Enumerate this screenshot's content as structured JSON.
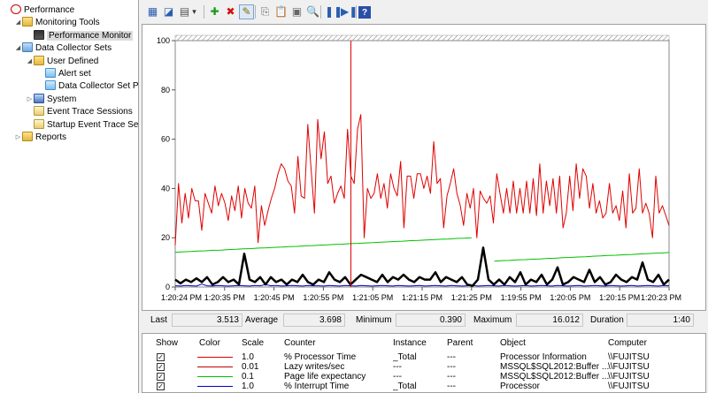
{
  "tree": {
    "items": [
      {
        "label": "Performance",
        "level": 0,
        "expander": "",
        "icon": "performance-icon",
        "cls": "ico-perf"
      },
      {
        "label": "Monitoring Tools",
        "level": 1,
        "expander": "◢",
        "icon": "folder-icon",
        "cls": "ico-folder"
      },
      {
        "label": "Performance Monitor",
        "level": 2,
        "expander": "",
        "icon": "monitor-icon",
        "cls": "ico-monitor",
        "selected": true
      },
      {
        "label": "Data Collector Sets",
        "level": 1,
        "expander": "◢",
        "icon": "data-collector-icon",
        "cls": "ico-dcs"
      },
      {
        "label": "User Defined",
        "level": 2,
        "expander": "◢",
        "icon": "user-defined-icon",
        "cls": "ico-user"
      },
      {
        "label": "Alert set",
        "level": 3,
        "expander": "",
        "icon": "alert-set-icon",
        "cls": "ico-alert"
      },
      {
        "label": "Data Collector Set P",
        "level": 3,
        "expander": "",
        "icon": "collector-set-icon",
        "cls": "ico-alert"
      },
      {
        "label": "System",
        "level": 2,
        "expander": "▷",
        "icon": "system-icon",
        "cls": "ico-sys"
      },
      {
        "label": "Event Trace Sessions",
        "level": 2,
        "expander": "",
        "icon": "event-trace-icon",
        "cls": "ico-trace"
      },
      {
        "label": "Startup Event Trace Ses",
        "level": 2,
        "expander": "",
        "icon": "startup-trace-icon",
        "cls": "ico-trace"
      },
      {
        "label": "Reports",
        "level": 1,
        "expander": "▷",
        "icon": "reports-icon",
        "cls": "ico-report"
      }
    ]
  },
  "toolbar": {
    "buttons": [
      {
        "name": "view-current-activity-button",
        "glyph": "▦",
        "color": "#2a5db0"
      },
      {
        "name": "view-log-data-button",
        "glyph": "◪",
        "color": "#2a5db0"
      },
      {
        "name": "change-graph-type-button",
        "glyph": "▤",
        "color": "#555"
      },
      {
        "name": "graph-type-dropdown-button",
        "glyph": "▾",
        "color": "#333"
      },
      {
        "name": "add-counter-button",
        "glyph": "✚",
        "color": "#1a9a1a"
      },
      {
        "name": "delete-counter-button",
        "glyph": "✖",
        "color": "#d01010"
      },
      {
        "name": "highlight-button",
        "glyph": "✎",
        "color": "#8a6a00",
        "active": true
      },
      {
        "name": "copy-properties-button",
        "glyph": "⎘",
        "color": "#777"
      },
      {
        "name": "paste-counter-list-button",
        "glyph": "📋",
        "color": "#777"
      },
      {
        "name": "properties-button",
        "glyph": "▣",
        "color": "#666"
      },
      {
        "name": "zoom-button",
        "glyph": "🔍",
        "color": "#555"
      },
      {
        "name": "freeze-display-button",
        "glyph": "❚❚",
        "color": "#2a5db0"
      },
      {
        "name": "update-data-button",
        "glyph": "▶❚",
        "color": "#2a5db0"
      },
      {
        "name": "help-button",
        "glyph": "?",
        "color": "#fff"
      }
    ]
  },
  "stats": {
    "last_label": "Last",
    "last_value": "3.513",
    "average_label": "Average",
    "average_value": "3.698",
    "minimum_label": "Minimum",
    "minimum_value": "0.390",
    "maximum_label": "Maximum",
    "maximum_value": "16.012",
    "duration_label": "Duration",
    "duration_value": "1:40"
  },
  "table": {
    "headers": {
      "show": "Show",
      "color": "Color",
      "scale": "Scale",
      "counter": "Counter",
      "instance": "Instance",
      "parent": "Parent",
      "object": "Object",
      "computer": "Computer"
    },
    "rows": [
      {
        "show": "✓",
        "color": "#e00000",
        "scale": "1.0",
        "counter": "% Processor Time",
        "instance": "_Total",
        "parent": "---",
        "object": "Processor Information",
        "computer": "\\\\FUJITSU"
      },
      {
        "show": "✓",
        "color": "#c00000",
        "scale": "0.01",
        "counter": "Lazy writes/sec",
        "instance": "---",
        "parent": "---",
        "object": "MSSQL$SQL2012:Buffer ...",
        "computer": "\\\\FUJITSU"
      },
      {
        "show": "✓",
        "color": "#00c000",
        "scale": "0.1",
        "counter": "Page life expectancy",
        "instance": "---",
        "parent": "---",
        "object": "MSSQL$SQL2012:Buffer ...",
        "computer": "\\\\FUJITSU"
      },
      {
        "show": "✓",
        "color": "#0000c0",
        "scale": "1.0",
        "counter": "% Interrupt Time",
        "instance": "_Total",
        "parent": "---",
        "object": "Processor",
        "computer": "\\\\FUJITSU"
      }
    ]
  },
  "chart_data": {
    "type": "line",
    "ylim": [
      0,
      100
    ],
    "yticks": [
      "0",
      "20",
      "40",
      "60",
      "80",
      "100"
    ],
    "xticks": [
      "1:20:24 PM",
      "1:20:35 PM",
      "1:20:45 PM",
      "1:20:55 PM",
      "1:21:05 PM",
      "1:21:15 PM",
      "1:21:25 PM",
      "1:19:55 PM",
      "1:20:05 PM",
      "1:20:15 PM",
      "1:20:23 PM"
    ],
    "current_position_index": 53,
    "series": [
      {
        "color": "#e00000",
        "width": 1,
        "values": [
          17,
          42,
          26,
          38,
          28,
          40,
          35,
          35,
          23,
          38,
          34,
          30,
          41,
          33,
          38,
          34,
          27,
          37,
          31,
          41,
          28,
          40,
          34,
          32,
          41,
          18,
          33,
          25,
          31,
          36,
          40,
          46,
          50,
          48,
          43,
          41,
          30,
          53,
          37,
          36,
          66,
          48,
          30,
          68,
          52,
          63,
          42,
          45,
          34,
          38,
          41,
          36,
          64,
          45,
          42,
          64,
          70,
          20,
          40,
          36,
          38,
          46,
          36,
          42,
          32,
          46,
          40,
          37,
          51,
          24,
          45,
          45,
          36,
          46,
          46,
          40,
          45,
          38,
          59,
          42,
          44,
          24,
          37,
          42,
          48,
          38,
          33,
          25,
          38,
          32,
          40,
          20,
          39,
          36,
          34,
          37,
          26,
          46,
          38,
          30,
          40,
          30,
          43,
          30,
          40,
          30,
          43,
          30,
          44,
          29,
          50,
          30,
          43,
          33,
          44,
          30,
          45,
          24,
          30,
          45,
          31,
          50,
          36,
          48,
          45,
          32,
          42,
          30,
          35,
          28,
          30,
          42,
          30,
          33,
          27,
          39,
          24,
          46,
          30,
          32,
          48,
          30,
          34,
          30,
          20,
          45,
          30,
          33,
          29,
          25
        ]
      },
      {
        "color": "#00c000",
        "width": 1,
        "values": [
          14.1,
          14.3,
          14.4,
          14.6,
          14.7,
          14.9,
          15,
          15.2,
          15.3,
          15.5,
          15.6,
          15.8,
          15.9,
          16.1,
          16.2,
          16.4,
          16.5,
          16.7,
          16.8,
          17,
          17.1,
          17.3,
          17.4,
          17.6,
          17.7,
          17.9,
          18,
          18.2,
          18.3,
          18.5,
          18.6,
          18.8,
          18.9,
          19.1,
          19.2,
          19.4,
          19.5,
          19.7,
          19.8,
          20,
          null,
          null,
          10.5,
          10.7,
          10.8,
          11,
          11.1,
          11.3,
          11.4,
          11.6,
          11.7,
          11.9,
          12,
          12.2,
          12.3,
          12.5,
          12.6,
          12.8,
          12.9,
          13.1,
          13.2,
          13.4,
          13.5,
          13.7,
          13.8,
          14
        ]
      },
      {
        "color": "#000000",
        "width": 2.5,
        "values": [
          3,
          1.5,
          3,
          2,
          3.5,
          2,
          4,
          1,
          2,
          4,
          2,
          3,
          1,
          13.5,
          3,
          2,
          4,
          1,
          4,
          2,
          3,
          1,
          3,
          2,
          5,
          2,
          1,
          3,
          2,
          6,
          3,
          2,
          4,
          1,
          3,
          5,
          4,
          3,
          2,
          5,
          2,
          4,
          3,
          5,
          3,
          2,
          4,
          3,
          3,
          6,
          2,
          4,
          3,
          2,
          4,
          1,
          0.5,
          3,
          16,
          3,
          1,
          3,
          1,
          4,
          2,
          6,
          1,
          3,
          2,
          5,
          1,
          3,
          8,
          1,
          2,
          4,
          3,
          2,
          7,
          2,
          4,
          1,
          2,
          5,
          3,
          2,
          4,
          3,
          10,
          3,
          2,
          5,
          1,
          3
        ]
      },
      {
        "color": "#0000c0",
        "width": 1,
        "values": [
          0.5,
          0.4,
          0.6,
          0.5,
          0.4,
          1.2,
          0.5,
          0.4,
          0.6,
          0.5,
          0.4,
          0.5,
          0.6,
          0.5,
          0.4,
          0.6,
          0.5,
          1,
          0.5,
          0.6,
          0.4,
          0.5,
          0.6,
          0.5,
          0.4,
          0.6,
          0.5,
          0.5,
          0.4,
          0.6,
          0.5,
          0.4,
          0.6,
          0.5,
          0.4,
          0.6,
          0.5,
          0.4,
          0.5,
          0.6,
          0.5,
          0.4,
          0.6,
          0.5,
          0.4,
          0.5,
          0.6,
          0.4,
          0.5,
          0.6,
          0.5,
          0.4,
          0.6,
          0.5,
          0.4,
          0.5,
          0.6,
          0.4,
          0.5,
          0.6,
          0.5,
          0.4,
          0.6,
          0.5,
          0.4,
          0.5,
          0.6,
          0.4,
          0.5,
          0.6,
          0.5,
          0.4,
          0.6,
          0.5,
          0.4,
          0.5,
          0.6,
          0.4,
          0.5,
          0.6,
          0.5,
          0.4,
          0.6,
          0.5,
          0.4,
          0.5,
          0.6,
          0.4,
          0.5,
          0.6,
          0.5,
          0.4,
          0.6,
          0.5
        ]
      }
    ]
  }
}
